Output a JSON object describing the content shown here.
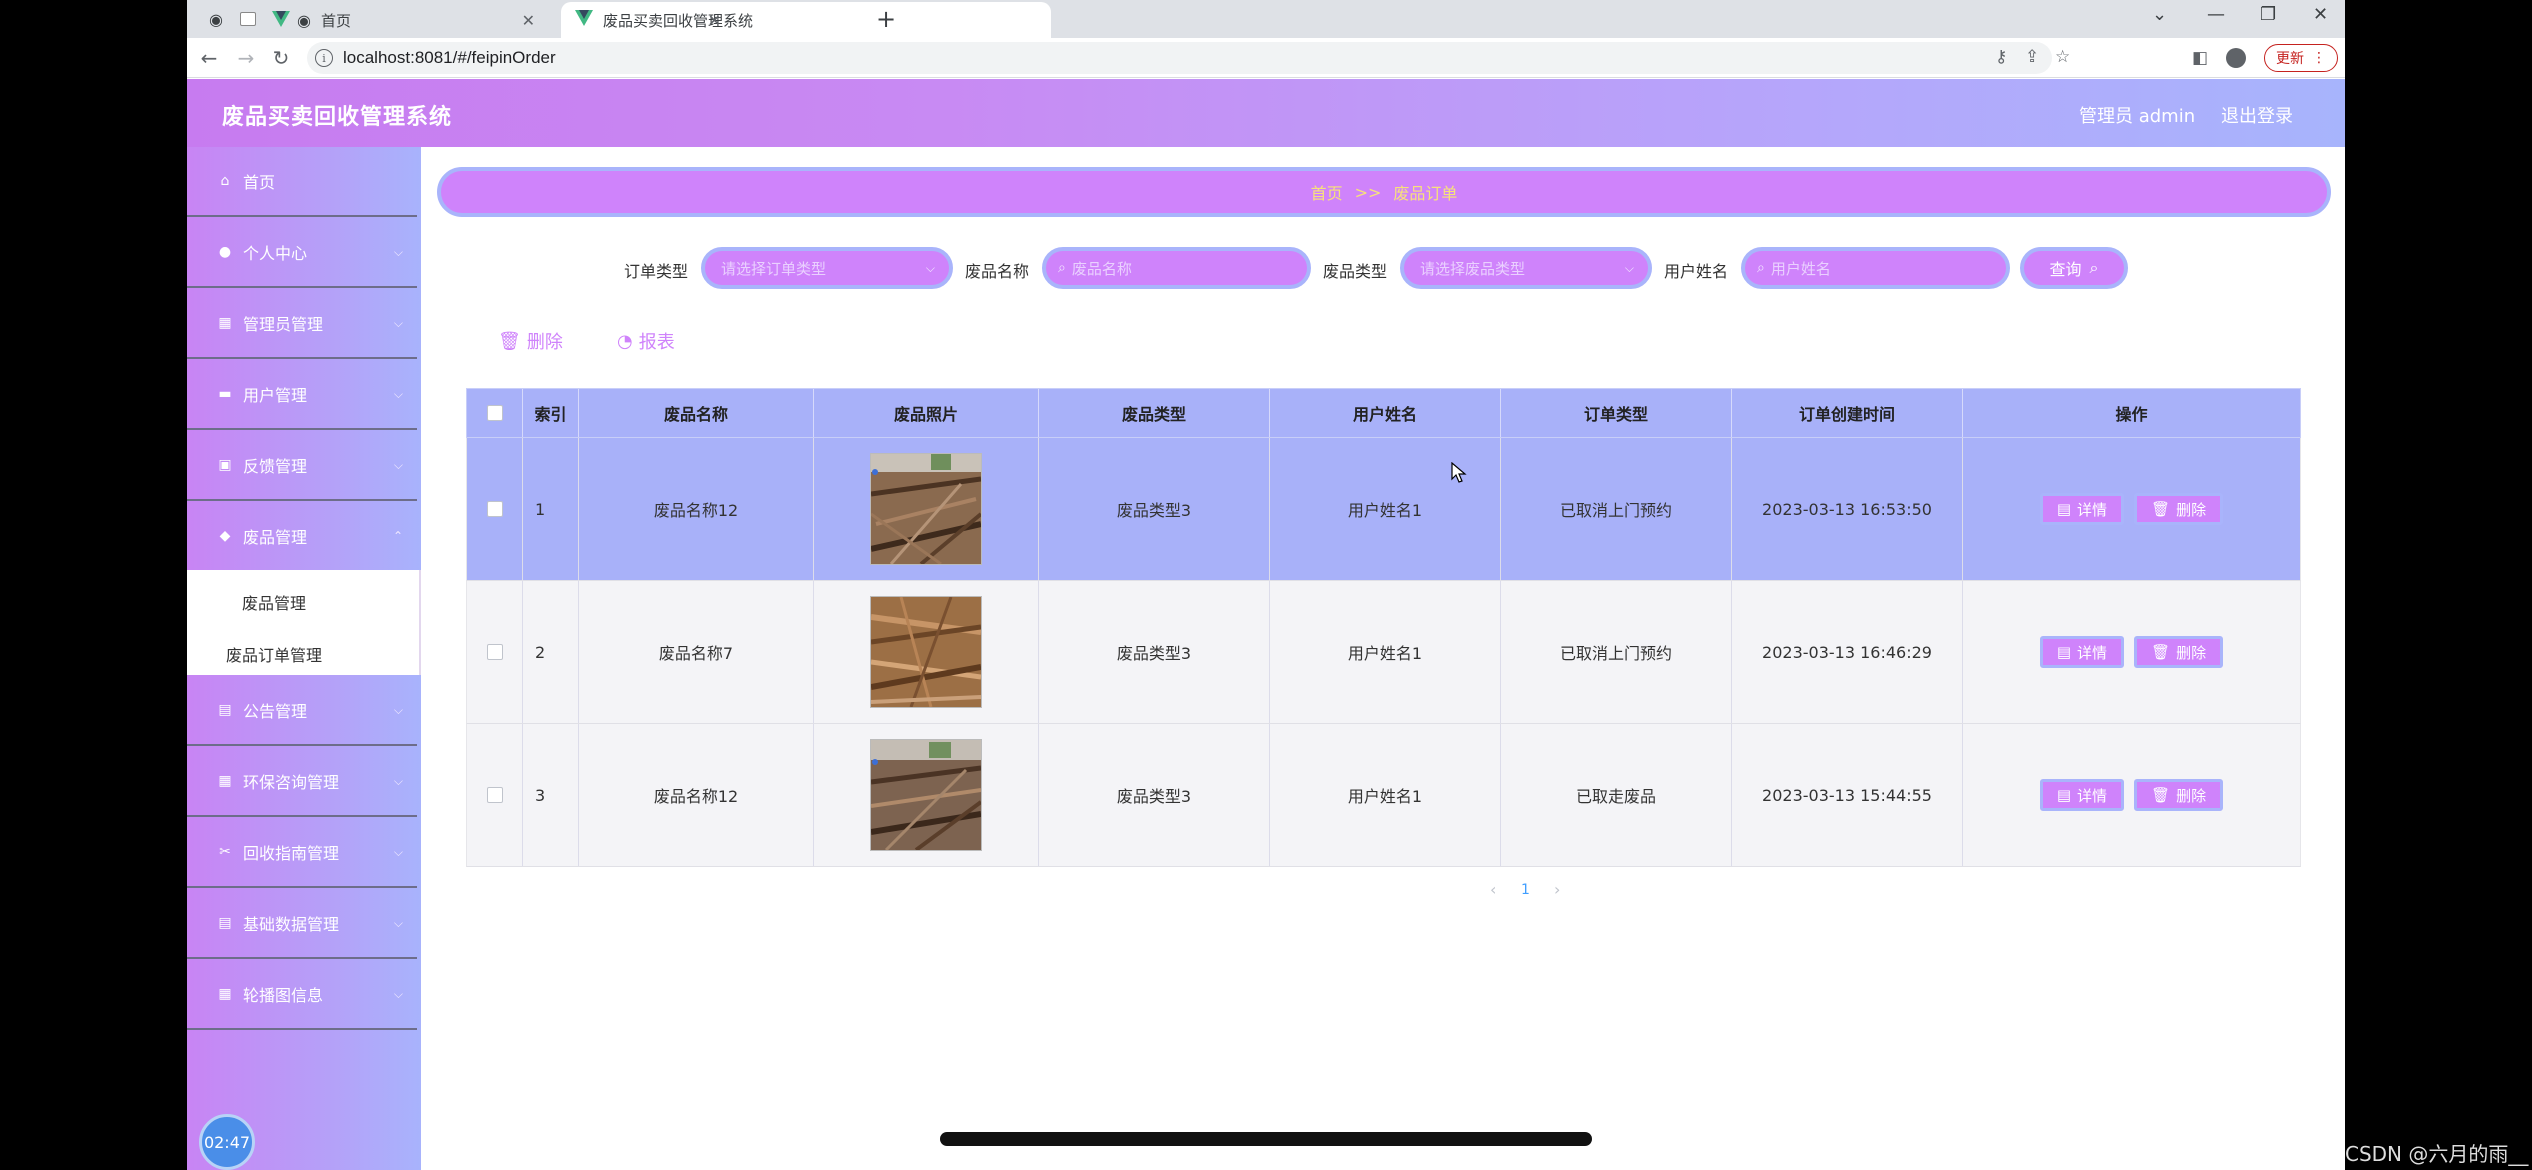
{
  "browser": {
    "tabs": [
      {
        "label": "首页",
        "active": false
      },
      {
        "label": "废品买卖回收管理系统",
        "active": true
      }
    ],
    "url": "localhost:8081/#/feipinOrder",
    "update_label": "更新"
  },
  "app": {
    "title": "废品买卖回收管理系统",
    "user_label": "管理员 admin",
    "logout_label": "退出登录",
    "brand_color": "#cf83fb"
  },
  "sidebar": {
    "items": [
      {
        "label": "首页",
        "icon": "home-icon"
      },
      {
        "label": "个人中心",
        "icon": "user-icon"
      },
      {
        "label": "管理员管理",
        "icon": "grid-icon"
      },
      {
        "label": "用户管理",
        "icon": "chat-icon"
      },
      {
        "label": "反馈管理",
        "icon": "briefcase-icon"
      },
      {
        "label": "废品管理",
        "icon": "location-icon"
      },
      {
        "label": "公告管理",
        "icon": "document-icon"
      },
      {
        "label": "环保咨询管理",
        "icon": "grid-icon"
      },
      {
        "label": "回收指南管理",
        "icon": "ticket-icon"
      },
      {
        "label": "基础数据管理",
        "icon": "document-icon"
      },
      {
        "label": "轮播图信息",
        "icon": "grid-icon"
      }
    ],
    "submenu": [
      "废品管理",
      "废品订单管理"
    ],
    "clock": "02:47"
  },
  "breadcrumb": {
    "home": "首页",
    "sep": ">>",
    "current": "废品订单"
  },
  "search": {
    "order_type_label": "订单类型",
    "order_type_placeholder": "请选择订单类型",
    "name_label": "废品名称",
    "name_placeholder": "废品名称",
    "type_label": "废品类型",
    "type_placeholder": "请选择废品类型",
    "user_label": "用户姓名",
    "user_placeholder": "用户姓名",
    "query_label": "查询"
  },
  "actions": {
    "delete_label": "删除",
    "report_label": "报表"
  },
  "table": {
    "headers": [
      "索引",
      "废品名称",
      "废品照片",
      "废品类型",
      "用户姓名",
      "订单类型",
      "订单创建时间",
      "操作"
    ],
    "rows": [
      {
        "index": "1",
        "name": "废品名称12",
        "type": "废品类型3",
        "user": "用户姓名1",
        "order_type": "已取消上门预约",
        "created": "2023-03-13 16:53:50",
        "selected": true
      },
      {
        "index": "2",
        "name": "废品名称7",
        "type": "废品类型3",
        "user": "用户姓名1",
        "order_type": "已取消上门预约",
        "created": "2023-03-13 16:46:29",
        "selected": false
      },
      {
        "index": "3",
        "name": "废品名称12",
        "type": "废品类型3",
        "user": "用户姓名1",
        "order_type": "已取走废品",
        "created": "2023-03-13 15:44:55",
        "selected": false
      }
    ],
    "detail_label": "详情",
    "delete_label": "删除"
  },
  "pagination": {
    "prev": "‹",
    "page": "1",
    "next": "›"
  },
  "watermark": "CSDN @六月的雨__"
}
